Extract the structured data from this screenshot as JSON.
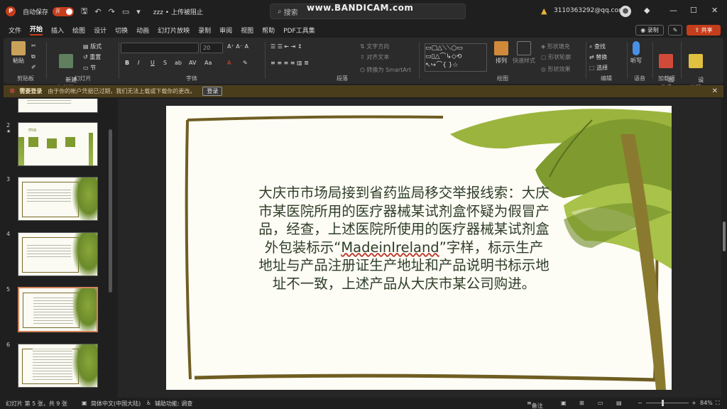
{
  "titlebar": {
    "autosave_label": "自动保存",
    "autosave_toggle": "开",
    "doc_title": "zzz • 上传被阻止",
    "search_placeholder": "搜索",
    "watermark": "www.BANDICAM.com",
    "account": "3110363292@qq.com"
  },
  "menu": [
    "文件",
    "开始",
    "插入",
    "绘图",
    "设计",
    "切换",
    "动画",
    "幻灯片放映",
    "录制",
    "审阅",
    "视图",
    "帮助",
    "PDF工具集"
  ],
  "buttons": {
    "record": "录制",
    "share": "共享"
  },
  "ribbon": {
    "paste": "粘贴",
    "clipboard": "剪贴板",
    "new_slide": "新建\n幻灯片",
    "layout": "版式",
    "reset": "重置",
    "section": "节",
    "slides": "幻灯片",
    "font_size": "20",
    "font": "字体",
    "text_direction": "文字方向",
    "align_text": "对齐文本",
    "smartart": "转换为 SmartArt",
    "paragraph": "段落",
    "arrange": "排列",
    "quick_styles": "快速样式",
    "shape_fill": "形状填充",
    "shape_outline": "形状轮廓",
    "shape_effects": "形状效果",
    "drawing": "绘图",
    "find": "查找",
    "replace": "替换",
    "select": "选择",
    "editing": "编辑",
    "dictate": "听写",
    "voice": "语音",
    "addins": "加\n载项",
    "addins_group": "加载项",
    "designer": "设\n计器"
  },
  "notice": {
    "title": "需要登录",
    "message": "由于你的帐户凭据已过期，我们无法上载或下载你的更改。",
    "login": "登录"
  },
  "thumbnails": [
    {
      "num": "2",
      "label": "ma"
    },
    {
      "num": "3"
    },
    {
      "num": "4"
    },
    {
      "num": "5"
    },
    {
      "num": "6"
    }
  ],
  "slide": {
    "text_part1": "大庆市市场局接到省药监局移交举报线索：大庆市某医院所用的医疗器械某试剂盒怀疑为假冒产品，经查，上述医院所使用的医疗器械某试剂盒外包装标示“",
    "text_word": "MadeinIreland",
    "text_part2": "”字样，标示生产地址与产品注册证生产地址和产品说明书标示地址不一致，上述产品从大庆市某公司购进。"
  },
  "status": {
    "slide_info": "幻灯片 第 5 张，共 9 张",
    "language": "简体中文(中国大陆)",
    "accessibility": "辅助功能: 调查",
    "notes": "备注",
    "zoom": "84%"
  },
  "colors": {
    "accent": "#c43e1c",
    "leaf": "#7f9a2e",
    "frame": "#6f5e22"
  }
}
